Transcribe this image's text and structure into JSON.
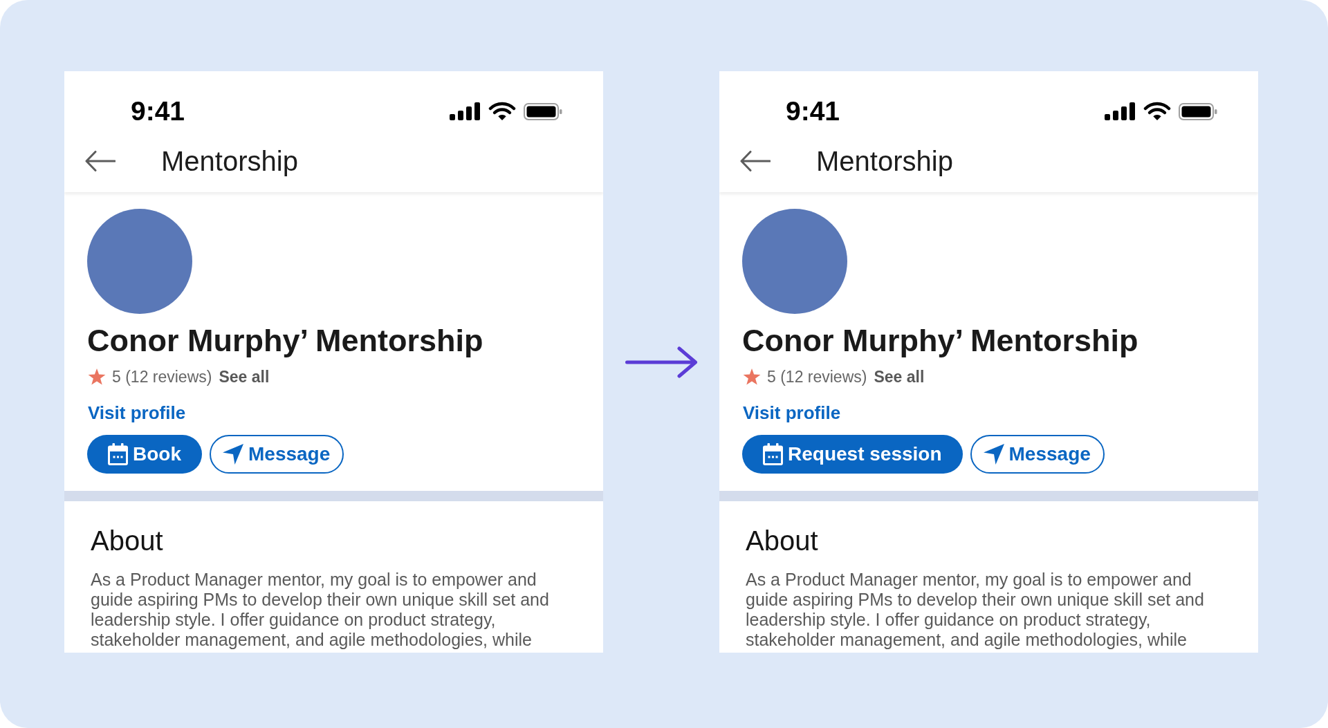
{
  "screens": [
    {
      "status_bar": {
        "time": "9:41"
      },
      "header": {
        "title": "Mentorship"
      },
      "profile": {
        "name": "Conor Murphy’ Mentorship",
        "rating": "5 (12 reviews)",
        "reviews_link": "See all",
        "profile_link": "Visit profile",
        "actions": [
          {
            "kind": "book",
            "label": "Book"
          },
          {
            "kind": "message",
            "label": "Message"
          }
        ]
      },
      "about": {
        "heading": "About",
        "text": "As a Product Manager mentor, my goal is to empower and guide aspiring PMs to develop their own unique skill set and leadership style. I offer guidance on product strategy, stakeholder management, and agile methodologies, while"
      }
    },
    {
      "status_bar": {
        "time": "9:41"
      },
      "header": {
        "title": "Mentorship"
      },
      "profile": {
        "name": "Conor Murphy’ Mentorship",
        "rating": "5 (12 reviews)",
        "reviews_link": "See all",
        "profile_link": "Visit profile",
        "actions": [
          {
            "kind": "request_session",
            "label": "Request session"
          },
          {
            "kind": "message",
            "label": "Message"
          }
        ]
      },
      "about": {
        "heading": "About",
        "text": "As a Product Manager mentor, my goal is to empower and guide aspiring PMs to develop their own unique skill set and leadership style. I offer guidance on product strategy, stakeholder management, and agile methodologies, while"
      }
    }
  ]
}
